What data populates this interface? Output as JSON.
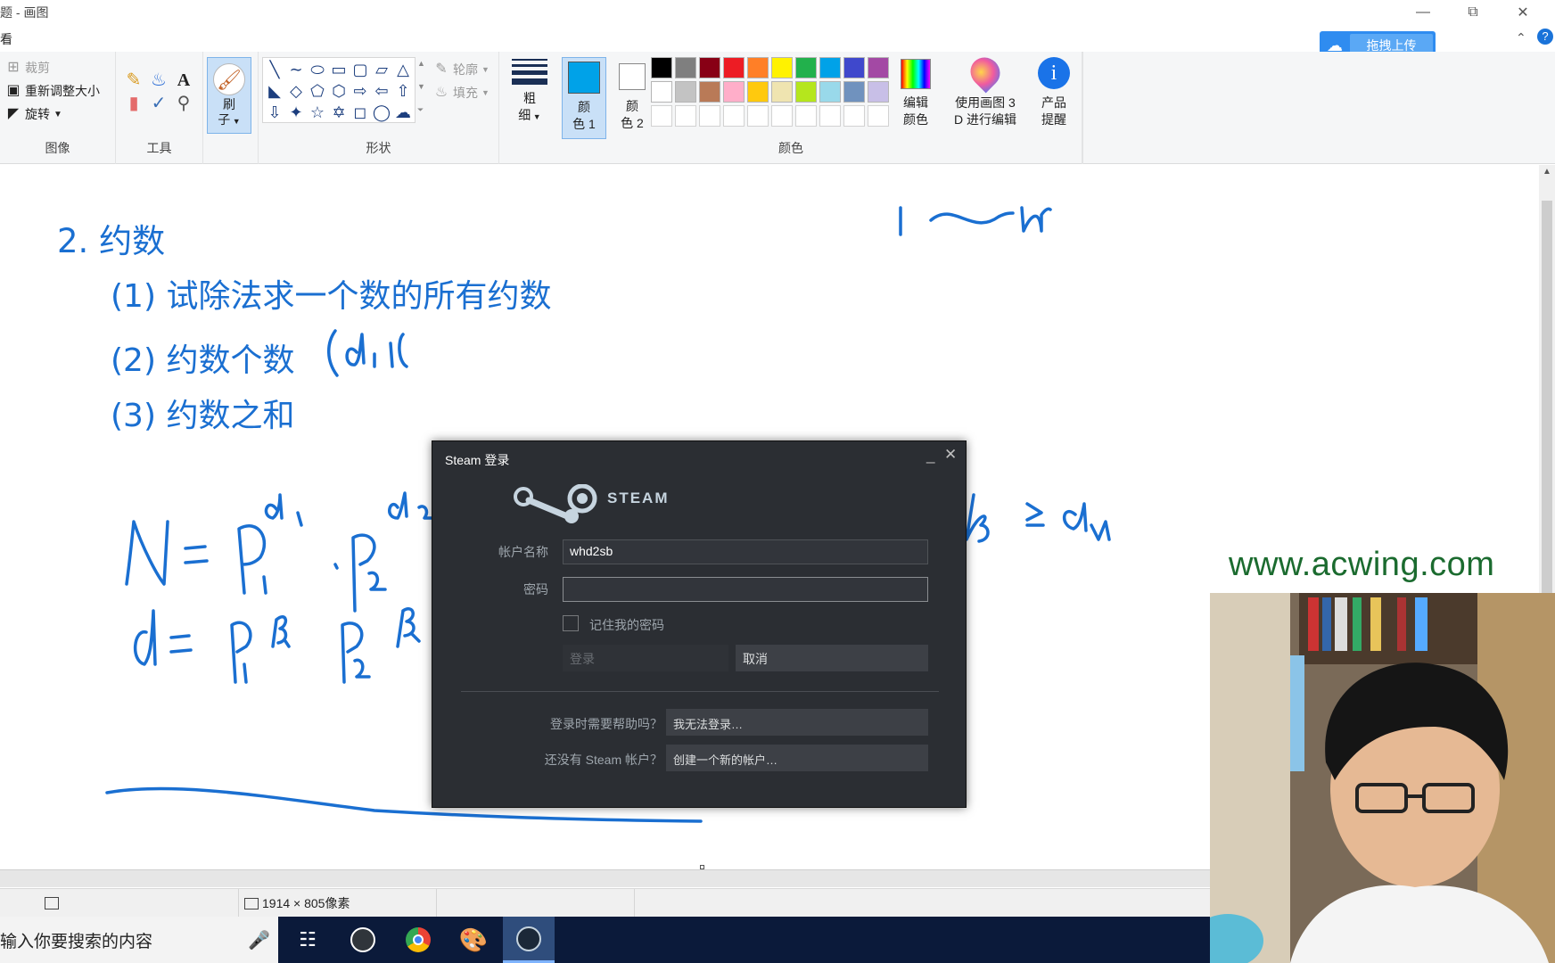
{
  "window": {
    "title": "题 - 画图",
    "menu": "看",
    "minimize_icon": "minimize-icon",
    "restore_icon": "restore-icon",
    "close_icon": "close-icon"
  },
  "baidu": {
    "label": "拖拽上传"
  },
  "ribbon": {
    "image_group": {
      "label": "图像",
      "crop": "裁剪",
      "resize": "重新调整大小",
      "rotate": "旋转"
    },
    "tools_group": {
      "label": "工具"
    },
    "brush": {
      "label_line1": "刷",
      "label_line2": "子"
    },
    "shapes_group": {
      "label": "形状",
      "outline": "轮廓",
      "fill": "填充"
    },
    "size": {
      "label_line1": "粗",
      "label_line2": "细"
    },
    "color1": {
      "label_line1": "颜",
      "label_line2": "色 1"
    },
    "color2": {
      "label_line1": "颜",
      "label_line2": "色 2"
    },
    "colors_group": {
      "label": "颜色",
      "row1": [
        "#000000",
        "#7f7f7f",
        "#880015",
        "#ed1c24",
        "#ff7f27",
        "#fff200",
        "#22b14c",
        "#00a2e8",
        "#3f48cc",
        "#a349a4"
      ],
      "row2": [
        "#ffffff",
        "#c3c3c3",
        "#b97a57",
        "#ffaec9",
        "#ffc90e",
        "#efe4b0",
        "#b5e61d",
        "#99d9ea",
        "#7092be",
        "#c8bfe7"
      ]
    },
    "edit_colors": {
      "label_line1": "编辑",
      "label_line2": "颜色"
    },
    "paint3d": {
      "label_line1": "使用画图 3",
      "label_line2": "D 进行编辑"
    },
    "product_alert": {
      "label_line1": "产品",
      "label_line2": "提醒"
    }
  },
  "canvas_notes": {
    "heading": "2. 约数",
    "item1": "(1) 试除法求一个数的所有约数",
    "item2": "(2) 约数个数",
    "item3": "(3) 约数之和"
  },
  "steam": {
    "title": "Steam 登录",
    "brand": "STEAM",
    "account_label": "帐户名称",
    "account_value": "whd2sb",
    "password_label": "密码",
    "password_value": "",
    "remember_label": "记住我的密码",
    "login_button": "登录",
    "cancel_button": "取消",
    "help_label": "登录时需要帮助吗？",
    "help_button": "我无法登录…",
    "no_account_label": "还没有 Steam 帐户？",
    "create_button": "创建一个新的帐户…"
  },
  "statusbar": {
    "dimensions": "1914 × 805像素"
  },
  "taskbar": {
    "search_placeholder": "输入你要搜索的内容"
  },
  "watermark": "www.acwing.com"
}
